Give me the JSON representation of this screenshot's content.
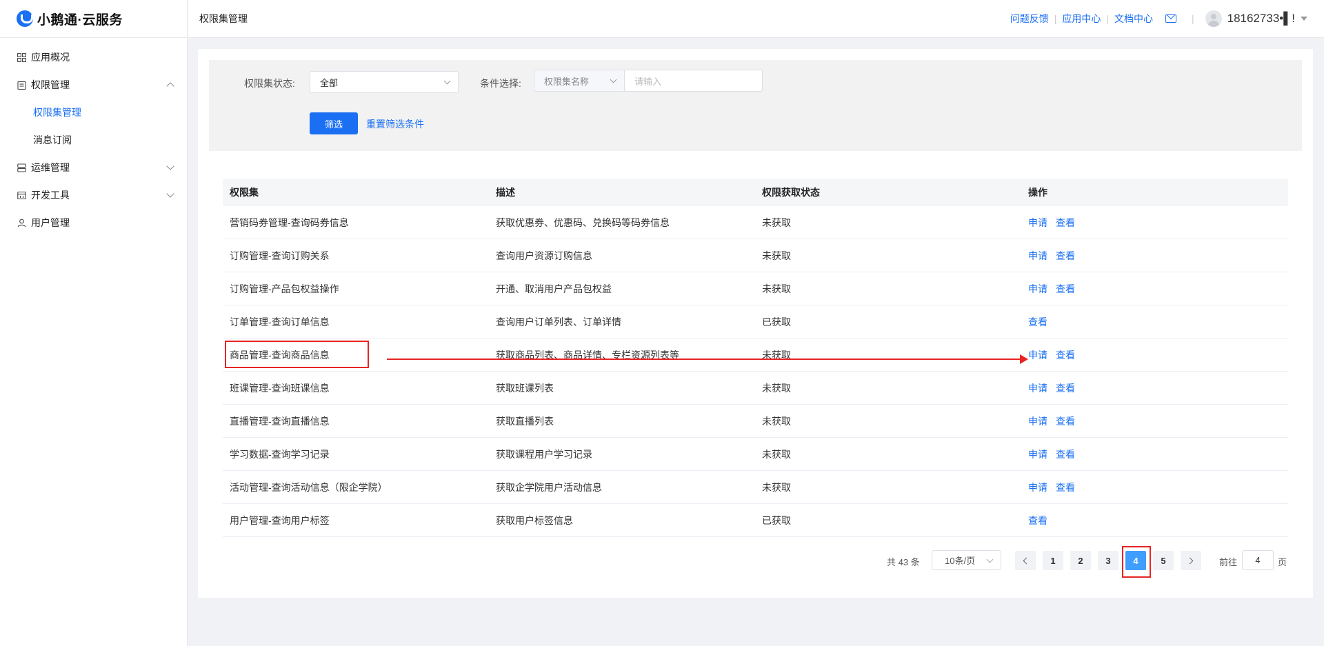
{
  "brand": {
    "name": "小鹅通·云服务",
    "color": "#1a6ff3"
  },
  "sidebar": {
    "items": [
      {
        "label": "应用概况",
        "icon": "dashboard-icon"
      },
      {
        "label": "权限管理",
        "icon": "clipboard-icon",
        "expanded": true,
        "children": [
          {
            "label": "权限集管理",
            "active": true
          },
          {
            "label": "消息订阅"
          }
        ]
      },
      {
        "label": "运维管理",
        "icon": "server-icon",
        "expanded": false
      },
      {
        "label": "开发工具",
        "icon": "window-icon",
        "expanded": false
      },
      {
        "label": "用户管理",
        "icon": "user-icon"
      }
    ]
  },
  "header": {
    "title": "权限集管理",
    "links": [
      "问题反馈",
      "应用中心",
      "文档中心"
    ],
    "user": "18162733•▌!"
  },
  "filter": {
    "status_label": "权限集状态:",
    "status_value": "全部",
    "condition_label": "条件选择:",
    "condition_value": "权限集名称",
    "input_placeholder": "请输入",
    "filter_button": "筛选",
    "reset_link": "重置筛选条件"
  },
  "table": {
    "headers": [
      "权限集",
      "描述",
      "权限获取状态",
      "操作"
    ],
    "rows": [
      {
        "name": "营销码券管理-查询码券信息",
        "desc": "获取优惠券、优惠码、兑换码等码券信息",
        "status": "未获取",
        "ops": [
          "申请",
          "查看"
        ]
      },
      {
        "name": "订购管理-查询订购关系",
        "desc": "查询用户资源订购信息",
        "status": "未获取",
        "ops": [
          "申请",
          "查看"
        ]
      },
      {
        "name": "订购管理-产品包权益操作",
        "desc": "开通、取消用户产品包权益",
        "status": "未获取",
        "ops": [
          "申请",
          "查看"
        ]
      },
      {
        "name": "订单管理-查询订单信息",
        "desc": "查询用户订单列表、订单详情",
        "status": "已获取",
        "ops": [
          "查看"
        ]
      },
      {
        "name": "商品管理-查询商品信息",
        "desc": "获取商品列表、商品详情、专栏资源列表等",
        "status": "未获取",
        "ops": [
          "申请",
          "查看"
        ]
      },
      {
        "name": "班课管理-查询班课信息",
        "desc": "获取班课列表",
        "status": "未获取",
        "ops": [
          "申请",
          "查看"
        ]
      },
      {
        "name": "直播管理-查询直播信息",
        "desc": "获取直播列表",
        "status": "未获取",
        "ops": [
          "申请",
          "查看"
        ]
      },
      {
        "name": "学习数据-查询学习记录",
        "desc": "获取课程用户学习记录",
        "status": "未获取",
        "ops": [
          "申请",
          "查看"
        ]
      },
      {
        "name": "活动管理-查询活动信息（限企学院）",
        "desc": "获取企学院用户活动信息",
        "status": "未获取",
        "ops": [
          "申请",
          "查看"
        ]
      },
      {
        "name": "用户管理-查询用户标签",
        "desc": "获取用户标签信息",
        "status": "已获取",
        "ops": [
          "查看"
        ]
      }
    ]
  },
  "pagination": {
    "total": "共 43 条",
    "page_size": "10条/页",
    "pages": [
      "1",
      "2",
      "3",
      "4",
      "5"
    ],
    "current": "4",
    "goto_label": "前往",
    "goto_value": "4",
    "page_suffix": "页"
  },
  "annotation_color": "#e82323"
}
